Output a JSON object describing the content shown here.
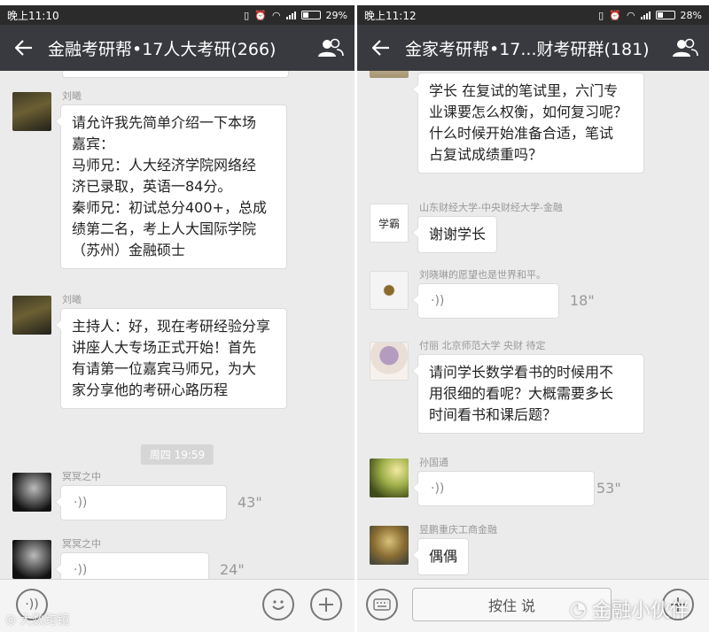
{
  "left": {
    "status": {
      "time": "晚上11:10",
      "battery": "29%"
    },
    "title": "金融考研帮•17人大考研(266)",
    "messages": [
      {
        "sender": "刘曦",
        "lines": [
          "请允许我先简单介绍一下本场",
          "嘉宾：",
          "马师兄：人大经济学院网络经",
          "济已录取，英语一84分。",
          "秦师兄：初试总分400+，总成",
          "绩第二名，考上人大国际学院",
          "（苏州）金融硕士"
        ]
      },
      {
        "sender": "刘曦",
        "lines": [
          "主持人：好，现在考研经验分享",
          "讲座人大专场正式开始！首先",
          "有请第一位嘉宾马师兄，为大",
          "家分享他的考研心路历程"
        ]
      },
      {
        "sender": "冥冥之中",
        "duration": "43\""
      },
      {
        "sender": "冥冥之中",
        "duration": "24\""
      }
    ],
    "time_divider": "周四 19:59",
    "watermark": "大数跨镜"
  },
  "right": {
    "status": {
      "time": "晚上11:12",
      "battery": "28%"
    },
    "title": "金家考研帮•17...财考研群(181)",
    "messages": [
      {
        "sender": "",
        "lines": [
          "学长 在复试的笔试里，六门专",
          "业课要怎么权衡，如何复习呢？",
          "什么时候开始准备合适，笔试",
          "占复试成绩重吗？"
        ]
      },
      {
        "sender": "山东财经大学-中央财经大学-金融",
        "lines": [
          "谢谢学长"
        ]
      },
      {
        "sender": "刘晓琳的愿望也是世界和平。",
        "duration": "18\""
      },
      {
        "sender": "付丽 北京师范大学 央财 待定",
        "lines": [
          "请问学长数学看书的时候用不",
          "用很细的看呢？大概需要多长",
          "时间看书和课后题？"
        ]
      },
      {
        "sender": "孙国通",
        "duration": "53\""
      },
      {
        "sender": "昱鹏重庆工商金融",
        "lines": [
          "偶偶"
        ]
      }
    ],
    "avatar_text": "学霸",
    "hold_to_talk": "按住 说",
    "watermark": "金融小伙伴"
  },
  "colors": {
    "titlebar": "#393a3f",
    "statusbar": "#2b2b2b",
    "chat_bg": "#ebebeb"
  }
}
